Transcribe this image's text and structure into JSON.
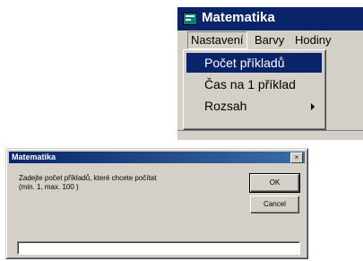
{
  "window": {
    "title": "Matematika",
    "menu": [
      "Nastavení",
      "Barvy",
      "Hodiny"
    ],
    "dropdown": [
      {
        "label": "Počet příkladů"
      },
      {
        "label": "Čas na 1 příklad"
      },
      {
        "label": "Rozsah"
      }
    ]
  },
  "dialog": {
    "title": "Matematika",
    "close": "×",
    "prompt_line1": "Zadejte počet příkladů, které chcete počítat",
    "prompt_line2": "(min. 1, max. 100 )",
    "ok": "OK",
    "cancel": "Cancel",
    "input_value": ""
  },
  "colors": {
    "titlebar": "#0a246a",
    "face": "#d4d0c8",
    "highlight": "#0a246a"
  }
}
